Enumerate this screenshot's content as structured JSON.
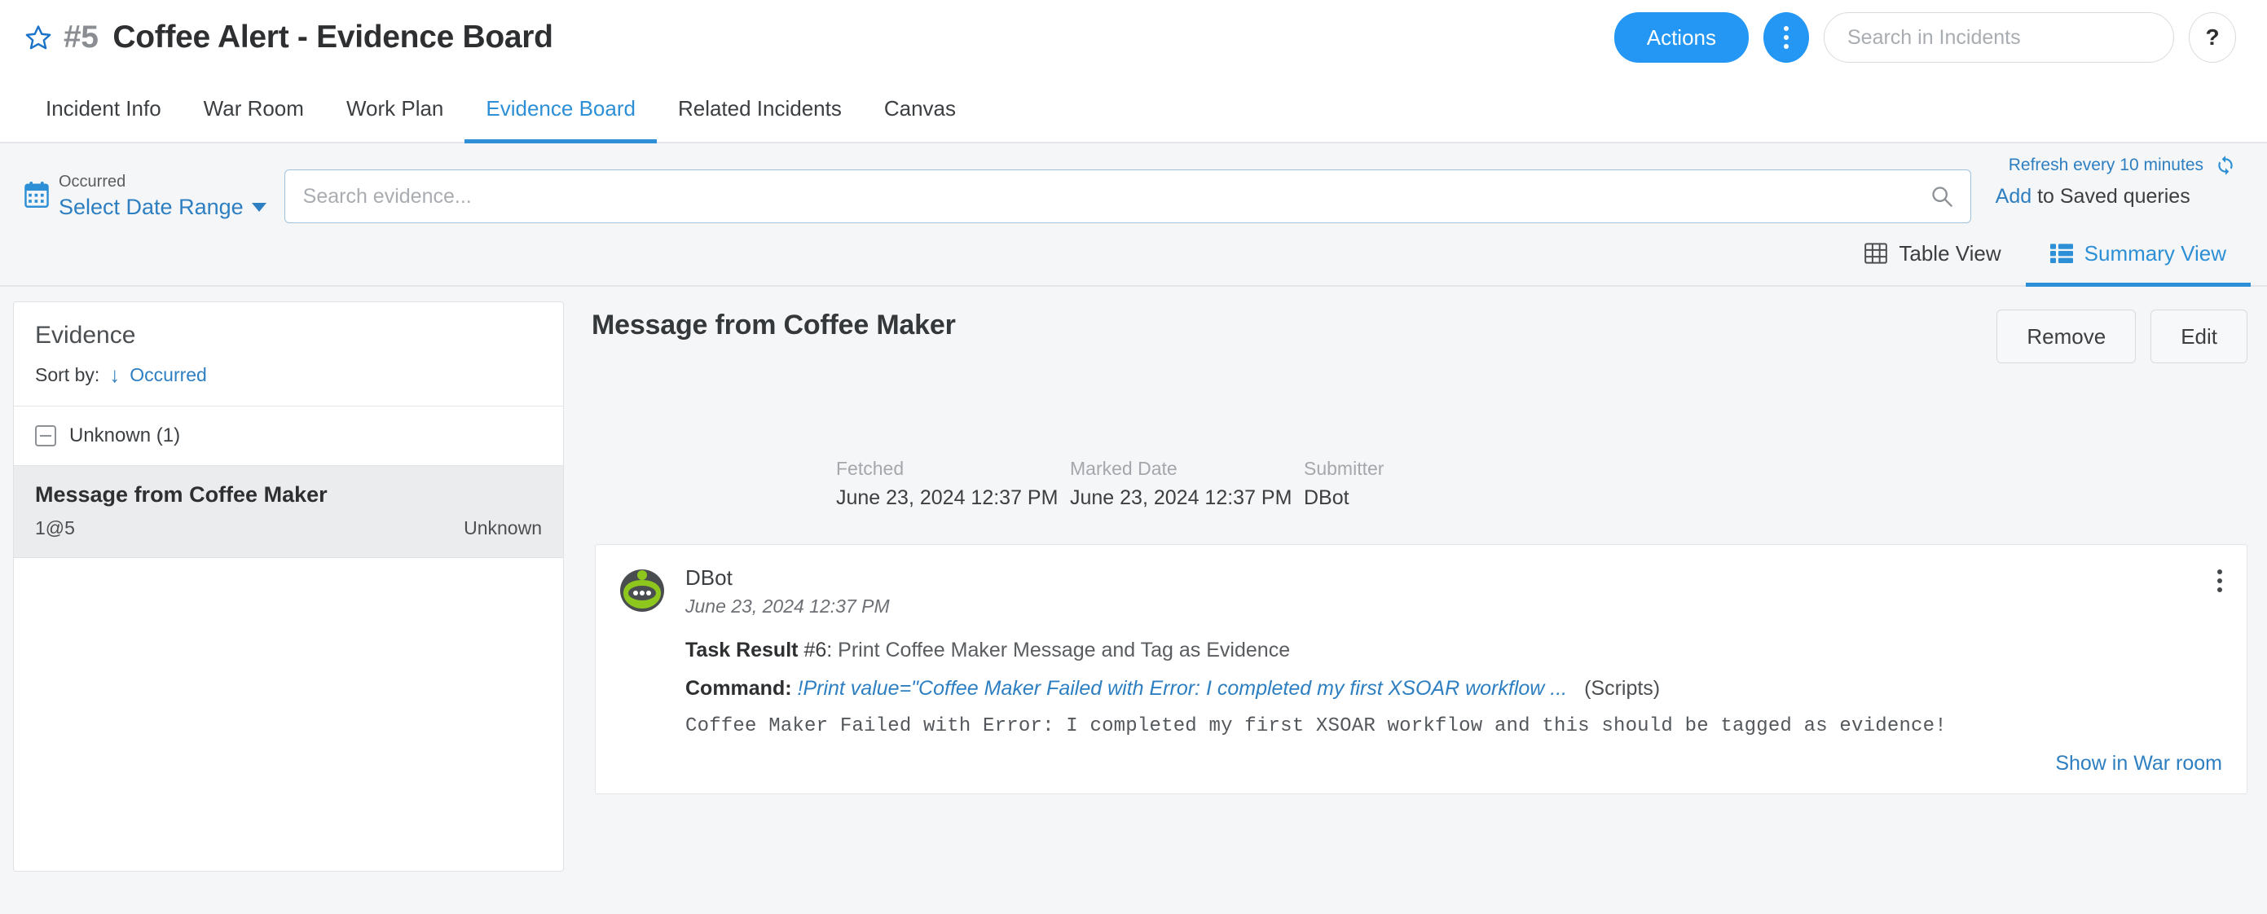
{
  "header": {
    "star_icon": "star-icon",
    "incident_number": "#5",
    "title": "Coffee Alert - Evidence Board",
    "actions_label": "Actions",
    "kebab_icon": "vertical-dots-icon",
    "search_placeholder": "Search in Incidents",
    "search_value": "",
    "help_label": "?"
  },
  "tabs": [
    {
      "label": "Incident Info",
      "active": false
    },
    {
      "label": "War Room",
      "active": false
    },
    {
      "label": "Work Plan",
      "active": false
    },
    {
      "label": "Evidence Board",
      "active": true
    },
    {
      "label": "Related Incidents",
      "active": false
    },
    {
      "label": "Canvas",
      "active": false
    }
  ],
  "query_bar": {
    "refresh_label": "Refresh every 10 minutes",
    "refresh_icon": "refresh-icon",
    "calendar_icon": "calendar-icon",
    "occurred_label": "Occurred",
    "date_range_label": "Select Date Range",
    "search_placeholder": "Search evidence...",
    "search_value": "",
    "search_icon": "search-icon",
    "add_link": "Add",
    "saved_queries_label": "to Saved queries"
  },
  "view_toggle": [
    {
      "label": "Table View",
      "icon": "table-grid-icon",
      "active": false
    },
    {
      "label": "Summary View",
      "icon": "list-summary-icon",
      "active": true
    }
  ],
  "sidebar": {
    "title": "Evidence",
    "sort_prefix": "Sort by:",
    "sort_arrow": "↓",
    "sort_value": "Occurred",
    "group": {
      "label": "Unknown (1)",
      "collapse_icon": "minus-square-icon"
    },
    "items": [
      {
        "title": "Message from Coffee Maker",
        "id": "1@5",
        "status": "Unknown"
      }
    ]
  },
  "main": {
    "title": "Message from Coffee Maker",
    "remove_label": "Remove",
    "edit_label": "Edit",
    "meta": [
      {
        "label": "Fetched",
        "value": "June 23, 2024 12:37 PM"
      },
      {
        "label": "Marked Date",
        "value": "June 23, 2024 12:37 PM"
      },
      {
        "label": "Submitter",
        "value": "DBot"
      }
    ],
    "card": {
      "avatar_icon": "dbot-avatar-icon",
      "author": "DBot",
      "timestamp": "June 23, 2024 12:37 PM",
      "kebab_icon": "vertical-dots-icon",
      "task_label": "Task Result",
      "task_number": "#6:",
      "task_name": "Print Coffee Maker Message and Tag as Evidence",
      "command_label": "Command:",
      "command_value": "!Print value=\"Coffee Maker Failed with Error: I completed my first XSOAR workflow ...",
      "command_source": "(Scripts)",
      "output": "Coffee Maker Failed with Error: I completed my first XSOAR workflow and this should be tagged as evidence!",
      "show_in_war_room": "Show in War room"
    }
  },
  "colors": {
    "accent_blue": "#2397f3",
    "link_blue": "#2d7fc1",
    "tab_active": "#2d8fd5",
    "avatar_green": "#8dc71e",
    "avatar_dark": "#4a4d4f"
  }
}
